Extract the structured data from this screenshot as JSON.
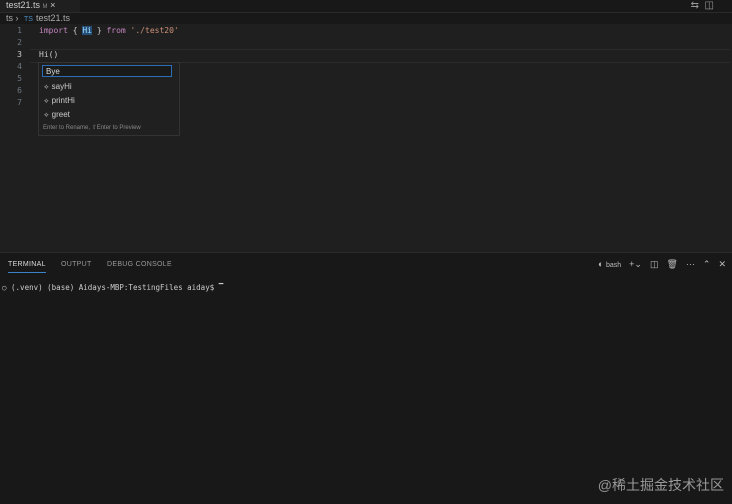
{
  "tab": {
    "label": "test21.ts",
    "flag": "M"
  },
  "breadcrumb": {
    "folder": "ts",
    "lang": "TS",
    "file": "test21.ts"
  },
  "editor": {
    "lines": [
      {
        "n": "1",
        "parts": [
          {
            "t": "import",
            "c": "kw"
          },
          {
            "t": " { "
          },
          {
            "t": "Hi",
            "c": "hl"
          },
          {
            "t": " } "
          },
          {
            "t": "from",
            "c": "kw"
          },
          {
            "t": " "
          },
          {
            "t": "'./test20'",
            "c": "str"
          }
        ]
      },
      {
        "n": "2",
        "parts": []
      },
      {
        "n": "3",
        "parts": [
          {
            "t": "Hi()"
          }
        ]
      },
      {
        "n": "4",
        "parts": []
      },
      {
        "n": "5",
        "parts": []
      },
      {
        "n": "6",
        "parts": []
      },
      {
        "n": "7",
        "parts": []
      }
    ]
  },
  "rename": {
    "value": "Bye",
    "suggestions": [
      "sayHi",
      "printHi",
      "greet"
    ],
    "hint": "Enter to Rename, ⇧Enter to Preview"
  },
  "panel": {
    "tabs": [
      "TERMINAL",
      "OUTPUT",
      "DEBUG CONSOLE"
    ],
    "shell": "bash",
    "prompt": "(.venv) (base) Aidays-MBP:TestingFiles aiday$ "
  },
  "watermark": "@稀土掘金技术社区"
}
